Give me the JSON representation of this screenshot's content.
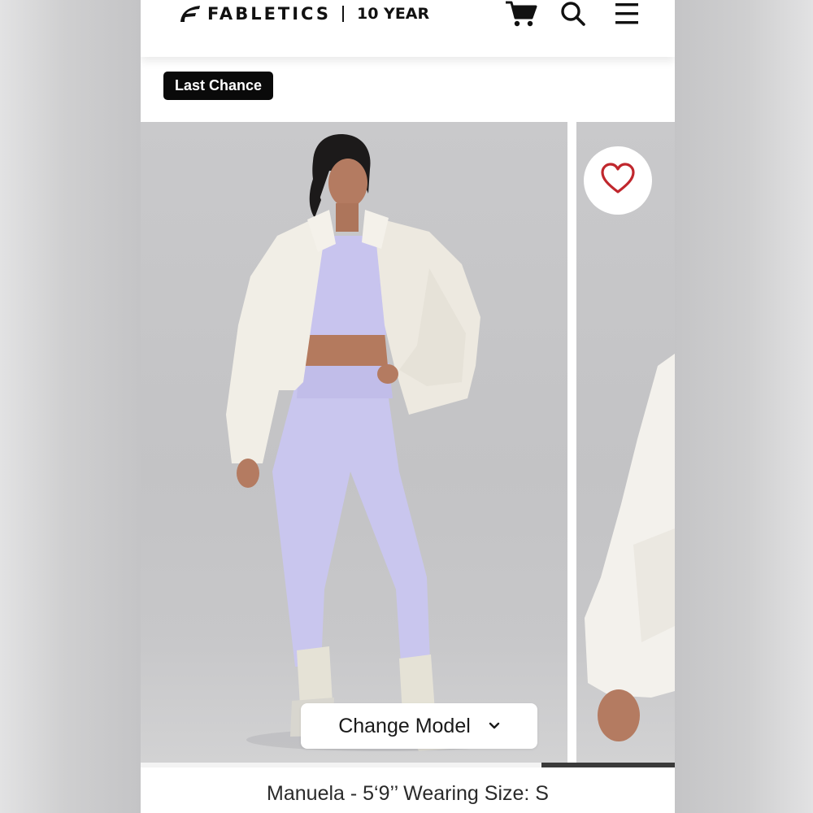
{
  "header": {
    "brand": "FABLETICS",
    "anniversary": "10 YEAR",
    "icons": [
      "cart-icon",
      "search-icon",
      "menu-icon"
    ]
  },
  "badge": {
    "label": "Last Chance",
    "color": "#0a0a0a"
  },
  "gallery": {
    "favorite_icon": "heart-icon",
    "favorite_color": "#c0272d",
    "change_model_label": "Change Model",
    "change_model_icon": "chevron-down-icon",
    "progress": 0.25,
    "progress_position": "right"
  },
  "model_caption": "Manuela - 5‘9’’ Wearing Size: S"
}
